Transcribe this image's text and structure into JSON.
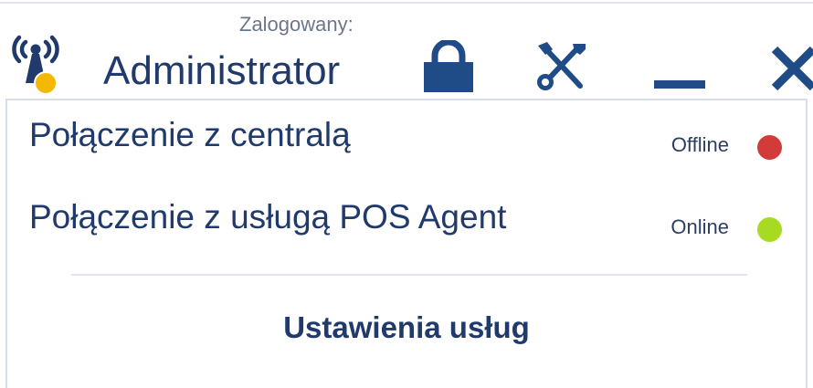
{
  "header": {
    "logged_in_label": "Zalogowany:",
    "user_name": "Administrator",
    "connection_indicator_color": "#f4b800",
    "accent_color": "#1f4b87",
    "buttons": [
      {
        "name": "lock-button",
        "icon": "lock-icon"
      },
      {
        "name": "settings-button",
        "icon": "tools-icon"
      },
      {
        "name": "minimize-button",
        "icon": "minimize-icon"
      },
      {
        "name": "close-button",
        "icon": "close-icon"
      }
    ]
  },
  "connections": [
    {
      "label": "Połączenie z centralą",
      "status": "Offline",
      "status_color": "#d33b3b"
    },
    {
      "label": "Połączenie z usługą POS Agent",
      "status": "Online",
      "status_color": "#a6db22"
    }
  ],
  "footer": {
    "settings_link": "Ustawienia usług"
  }
}
